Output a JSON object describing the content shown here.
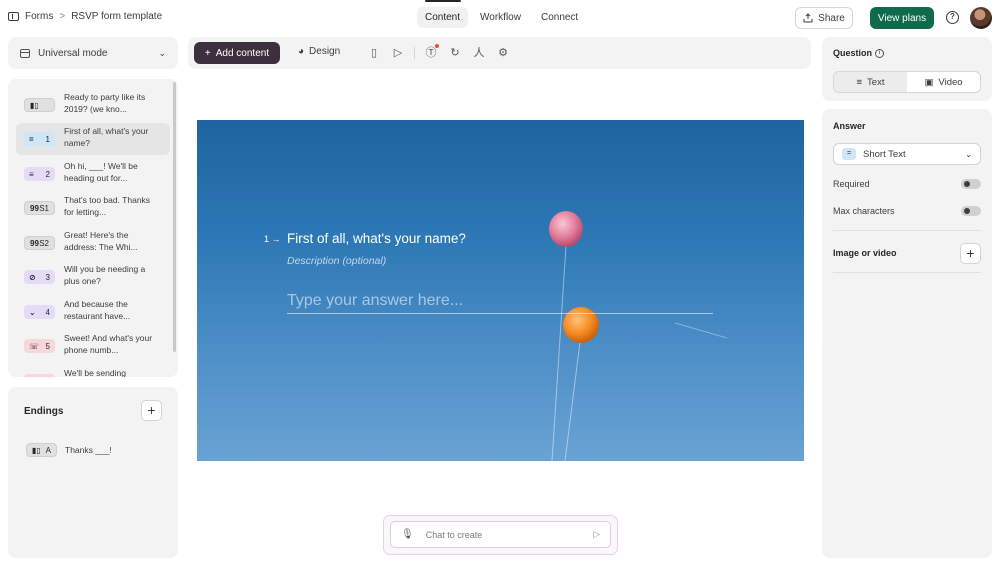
{
  "breadcrumb": {
    "root": "Forms",
    "separator": ">",
    "current": "RSVP form template"
  },
  "topnav": {
    "tabs": [
      "Content",
      "Workflow",
      "Connect"
    ],
    "active": "Content"
  },
  "header": {
    "share_label": "Share",
    "view_plans_label": "View plans"
  },
  "sidebar": {
    "mode_label": "Universal mode",
    "questions": [
      {
        "badge": "",
        "text": "Ready to party like its 2019? (we kno...",
        "color": "grey",
        "icon": "statement-icon"
      },
      {
        "badge": "1",
        "text": "First of all, what's your name?",
        "color": "blue",
        "icon": "short-text-icon"
      },
      {
        "badge": "2",
        "text": "Oh hi, ___! We'll be heading out for...",
        "color": "purple",
        "icon": "multiple-choice-icon"
      },
      {
        "badge": "S1",
        "text": "That's too bad. Thanks for letting...",
        "color": "grey",
        "icon": "quote-icon"
      },
      {
        "badge": "S2",
        "text": "Great! Here's the address: The Whi...",
        "color": "grey",
        "icon": "quote-icon"
      },
      {
        "badge": "3",
        "text": "Will you be needing a plus one?",
        "color": "purple",
        "icon": "yes-no-icon"
      },
      {
        "badge": "4",
        "text": "And because the restaurant have...",
        "color": "purple",
        "icon": "dropdown-icon"
      },
      {
        "badge": "5",
        "text": "Sweet! And what's your phone numb...",
        "color": "red",
        "icon": "phone-icon"
      },
      {
        "badge": "",
        "text": "We'll be sending",
        "color": "red",
        "icon": "email-icon"
      }
    ],
    "endings_title": "Endings",
    "endings": [
      {
        "badge": "A",
        "text": "Thanks ___!"
      }
    ]
  },
  "toolbar": {
    "add_content_label": "Add content",
    "design_label": "Design"
  },
  "canvas": {
    "question_number": "1",
    "question_title": "First of all, what's your name?",
    "description_placeholder": "Description (optional)",
    "answer_placeholder": "Type your answer here..."
  },
  "chat": {
    "placeholder": "Chat to create"
  },
  "right_panel": {
    "question_label": "Question",
    "type_options": [
      "Text",
      "Video"
    ],
    "type_active": "Text",
    "answer_label": "Answer",
    "answer_type": "Short Text",
    "required_label": "Required",
    "required_on": false,
    "max_chars_label": "Max characters",
    "max_chars_on": false,
    "media_label": "Image or video"
  },
  "colors": {
    "accent": "#0f6b4c",
    "add_button": "#3d2f3d",
    "canvas_top": "#1e64a0",
    "canvas_bottom": "#6aa3d4"
  }
}
